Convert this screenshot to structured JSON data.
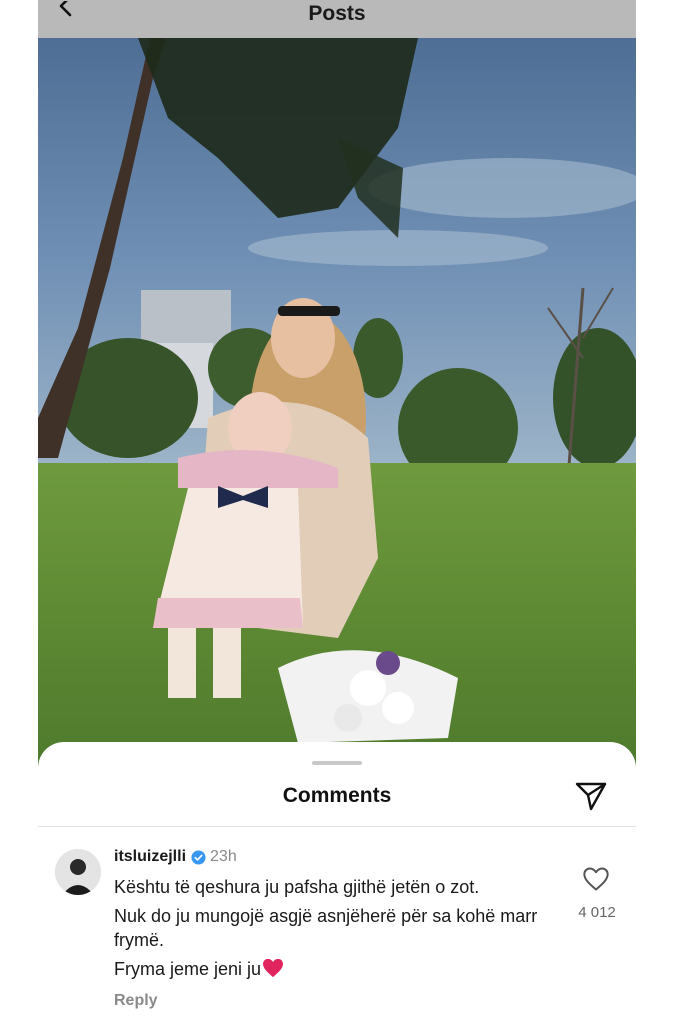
{
  "header": {
    "title": "Posts",
    "back_icon": "chevron-left-icon"
  },
  "post": {
    "image_icon": "photo"
  },
  "comments_sheet": {
    "title": "Comments",
    "share_icon": "paper-plane-icon",
    "comment": {
      "username": "itsluizejlli",
      "verified_icon": "verified-badge-icon",
      "time": "23h",
      "lines": [
        "Kështu të qeshura ju pafsha gjithë jetën o zot.",
        "Nuk do ju mungojë asgjë asnjëherë për sa kohë marr frymë.",
        "Fryma jeme jeni ju"
      ],
      "emoji": "red-heart-icon",
      "reply_label": "Reply",
      "like_icon": "heart-outline-icon",
      "like_count": "4 012"
    }
  },
  "colors": {
    "dim_bar": "#b9b9b9",
    "verified": "#3897f0",
    "muted": "#8a8a8a",
    "heart": "#e0245e"
  }
}
